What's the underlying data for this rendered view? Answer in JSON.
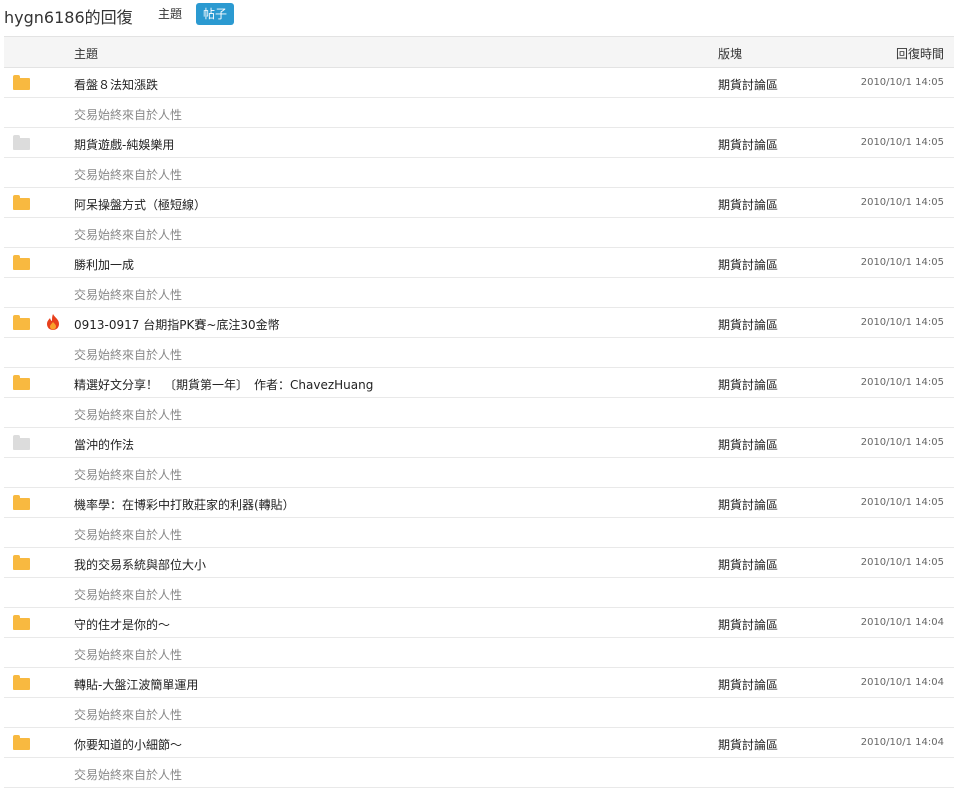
{
  "header": {
    "title": "hygn6186的回復",
    "tabs": [
      {
        "label": "主題",
        "active": false
      },
      {
        "label": "帖子",
        "active": true
      }
    ],
    "accent": "#2b9ad1"
  },
  "table": {
    "columns": {
      "subject": "主題",
      "forum": "版塊",
      "time": "回復時間"
    },
    "rows": [
      {
        "icon": "folder-orange-icon",
        "hot": false,
        "subject": "看盤８法知漲跌",
        "forum": "期貨討論區",
        "time": "2010/10/1 14:05",
        "excerpt": "交易始終來自於人性"
      },
      {
        "icon": "folder-gray-icon",
        "hot": false,
        "subject": "期貨遊戲-純娛樂用",
        "forum": "期貨討論區",
        "time": "2010/10/1 14:05",
        "excerpt": "交易始終來自於人性"
      },
      {
        "icon": "folder-orange-icon",
        "hot": false,
        "subject": "阿呆操盤方式（極短線）",
        "forum": "期貨討論區",
        "time": "2010/10/1 14:05",
        "excerpt": "交易始終來自於人性"
      },
      {
        "icon": "folder-orange-icon",
        "hot": false,
        "subject": "勝利加一成",
        "forum": "期貨討論區",
        "time": "2010/10/1 14:05",
        "excerpt": "交易始終來自於人性"
      },
      {
        "icon": "folder-orange-icon",
        "hot": true,
        "subject": "0913-0917 台期指PK賽~底注30金幣",
        "forum": "期貨討論區",
        "time": "2010/10/1 14:05",
        "excerpt": "交易始終來自於人性"
      },
      {
        "icon": "folder-orange-icon",
        "hot": false,
        "subject": "精選好文分享！　〔期貨第一年〕　作者：ChavezHuang",
        "forum": "期貨討論區",
        "time": "2010/10/1 14:05",
        "excerpt": "交易始終來自於人性"
      },
      {
        "icon": "folder-gray-icon",
        "hot": false,
        "subject": "當沖的作法",
        "forum": "期貨討論區",
        "time": "2010/10/1 14:05",
        "excerpt": "交易始終來自於人性"
      },
      {
        "icon": "folder-orange-icon",
        "hot": false,
        "subject": "機率學：在博彩中打敗莊家的利器(轉貼）",
        "forum": "期貨討論區",
        "time": "2010/10/1 14:05",
        "excerpt": "交易始終來自於人性"
      },
      {
        "icon": "folder-orange-icon",
        "hot": false,
        "subject": "我的交易系統與部位大小",
        "forum": "期貨討論區",
        "time": "2010/10/1 14:05",
        "excerpt": "交易始終來自於人性"
      },
      {
        "icon": "folder-orange-icon",
        "hot": false,
        "subject": "守的住才是你的～",
        "forum": "期貨討論區",
        "time": "2010/10/1 14:04",
        "excerpt": "交易始終來自於人性"
      },
      {
        "icon": "folder-orange-icon",
        "hot": false,
        "subject": "轉貼-大盤江波簡單運用",
        "forum": "期貨討論區",
        "time": "2010/10/1 14:04",
        "excerpt": "交易始終來自於人性"
      },
      {
        "icon": "folder-orange-icon",
        "hot": false,
        "subject": "你要知道的小細節～",
        "forum": "期貨討論區",
        "time": "2010/10/1 14:04",
        "excerpt": "交易始終來自於人性"
      }
    ]
  }
}
